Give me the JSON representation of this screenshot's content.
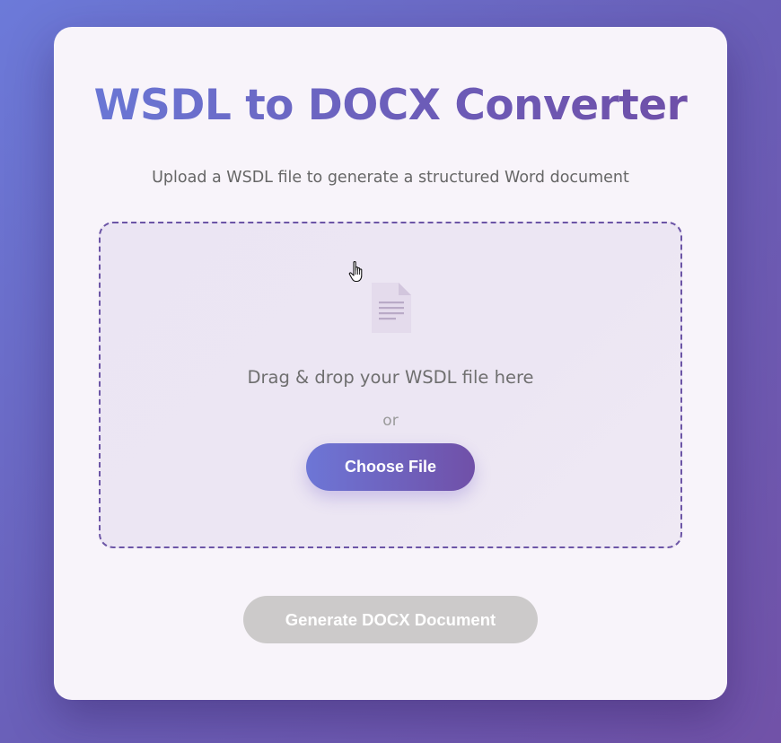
{
  "app": {
    "title": "WSDL to DOCX Converter",
    "subtitle": "Upload a WSDL file to generate a structured Word document"
  },
  "dropzone": {
    "icon": "document-icon",
    "drop_text": "Drag & drop your WSDL file here",
    "or_text": "or",
    "choose_label": "Choose File"
  },
  "actions": {
    "generate_label": "Generate DOCX Document",
    "generate_enabled": false
  },
  "colors": {
    "accent_start": "#6a7ad8",
    "accent_end": "#6f4ea6",
    "dropzone_border": "#6c55a6",
    "disabled_button": "#cccaca"
  }
}
